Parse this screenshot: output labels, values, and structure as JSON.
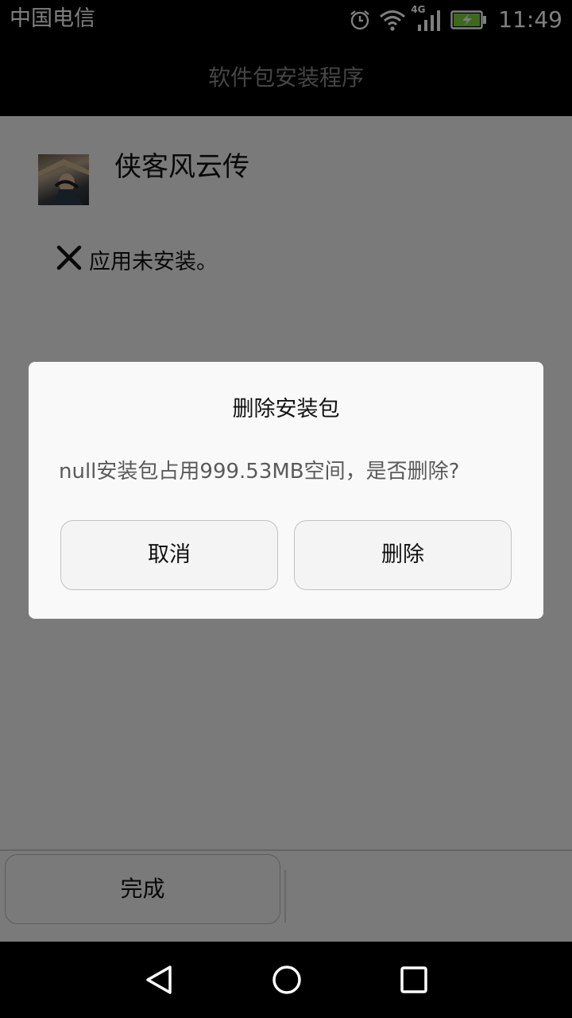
{
  "status_bar": {
    "carrier": "中国电信",
    "network_badge": "4G",
    "time": "11:49",
    "icons": [
      "alarm-icon",
      "wifi-icon",
      "cellular-signal-icon",
      "battery-charging-icon"
    ],
    "battery_color": "#7cd33a"
  },
  "action_bar": {
    "title": "软件包安装程序"
  },
  "app": {
    "name": "侠客风云传",
    "icon": "app-icon"
  },
  "result": {
    "icon": "close-icon",
    "text": "应用未安装。"
  },
  "bottom_bar": {
    "done_label": "完成"
  },
  "dialog": {
    "title": "删除安装包",
    "message": "null安装包占用999.53MB空间，是否删除?",
    "cancel_label": "取消",
    "delete_label": "删除"
  },
  "nav_bar": {
    "icons": [
      "back-icon",
      "home-icon",
      "recents-icon"
    ]
  }
}
